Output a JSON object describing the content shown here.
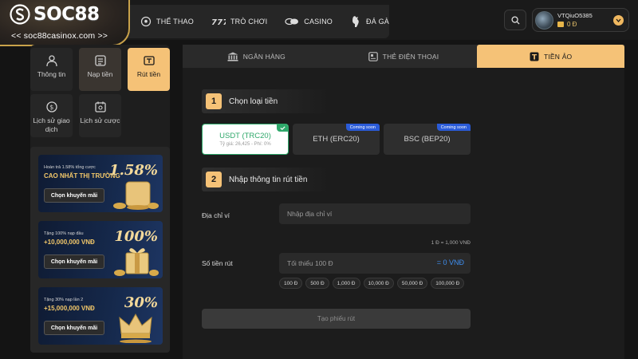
{
  "brand": {
    "logo": "SOC88",
    "url": "<< soc88casinox.com >>"
  },
  "nav": {
    "items": [
      {
        "label": "THỂ THAO",
        "icon": "soccer-icon"
      },
      {
        "label": "TRÒ CHƠI",
        "icon": "slot-777-icon"
      },
      {
        "label": "CASINO",
        "icon": "poker-chips-icon"
      },
      {
        "label": "ĐÁ GÀ",
        "icon": "rooster-icon"
      }
    ]
  },
  "user": {
    "name": "VTQiuO5385",
    "balance": "0 Đ"
  },
  "sidebar": {
    "menu": [
      {
        "label": "Thông tin",
        "icon": "user-icon"
      },
      {
        "label": "Nạp tiền",
        "icon": "deposit-icon"
      },
      {
        "label": "Rút tiền",
        "icon": "withdraw-icon"
      },
      {
        "label": "Lịch sử giao dịch",
        "icon": "transaction-history-icon"
      },
      {
        "label": "Lịch sử cược",
        "icon": "bet-history-icon"
      }
    ],
    "promos": [
      {
        "small": "Hoàn trả 1.58% tổng cược",
        "big": "CAO NHẤT THỊ TRƯỜNG",
        "pct": "1.58%",
        "cta": "Chọn khuyến mãi"
      },
      {
        "small": "Tặng 100% nạp đầu",
        "big": "+10,000,000 VNĐ",
        "pct": "100%",
        "cta": "Chọn khuyến mãi"
      },
      {
        "small": "Tặng 30% nạp lần 2",
        "big": "+15,000,000 VNĐ",
        "pct": "30%",
        "cta": "Chọn khuyến mãi"
      }
    ]
  },
  "tabs": [
    {
      "label": "NGÂN HÀNG",
      "icon": "bank-icon"
    },
    {
      "label": "THẺ ĐIỆN THOẠI",
      "icon": "phone-card-icon"
    },
    {
      "label": "TIỀN ẢO",
      "icon": "tether-icon"
    }
  ],
  "form": {
    "step1": {
      "num": "1",
      "title": "Chọn loại tiền"
    },
    "coins": [
      {
        "name": "USDT (TRC20)",
        "sub": "Tỷ giá: 26,425 - Phí: 0%",
        "badge": ""
      },
      {
        "name": "ETH (ERC20)",
        "sub": "",
        "badge": "Coming soon"
      },
      {
        "name": "BSC (BEP20)",
        "sub": "",
        "badge": "Coming soon"
      }
    ],
    "step2": {
      "num": "2",
      "title": "Nhập thông tin rút tiền"
    },
    "wallet_label": "Địa chỉ ví",
    "wallet_placeholder": "Nhập địa chỉ ví",
    "rate": "1 Đ = 1,000 VNĐ",
    "amount_label": "Số tiền rút",
    "amount_placeholder": "Tối thiểu 100 Đ",
    "amount_vnd": "= 0 VNĐ",
    "quick_amounts": [
      "100 Đ",
      "500 Đ",
      "1,000 Đ",
      "10,000 Đ",
      "50,000 Đ",
      "100,000 Đ"
    ],
    "submit": "Tạo phiếu rút"
  },
  "colors": {
    "accent": "#f5c277",
    "success": "#2ea86a",
    "badge": "#2a5bd8",
    "link": "#3f8ff0"
  }
}
